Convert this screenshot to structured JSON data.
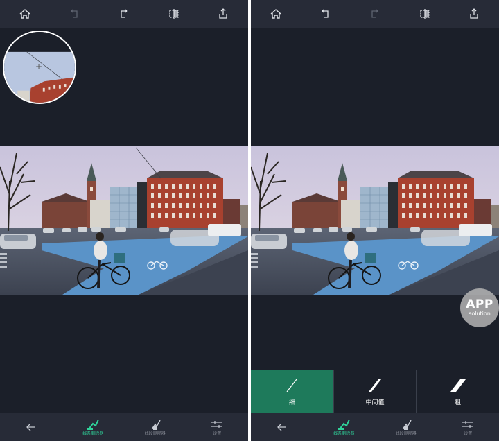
{
  "left_panel": {
    "bottom_nav": [
      {
        "icon": "back-arrow-icon",
        "label": ""
      },
      {
        "icon": "line-remover-icon",
        "label": "线条删除器",
        "active": true
      },
      {
        "icon": "wire-remover-icon",
        "label": "线段删除器",
        "active": false
      },
      {
        "icon": "settings-sliders-icon",
        "label": "设置",
        "active": false
      }
    ]
  },
  "right_panel": {
    "thickness_options": [
      {
        "label": "细",
        "selected": true
      },
      {
        "label": "中间值",
        "selected": false
      },
      {
        "label": "粗",
        "selected": false
      }
    ],
    "bottom_nav": [
      {
        "icon": "back-arrow-icon",
        "label": ""
      },
      {
        "icon": "line-remover-icon",
        "label": "线条删除器",
        "active": true
      },
      {
        "icon": "wire-remover-icon",
        "label": "线段删除器",
        "active": false
      },
      {
        "icon": "settings-sliders-icon",
        "label": "设置",
        "active": false
      }
    ]
  },
  "watermark": {
    "main": "APP",
    "sub": "solution"
  },
  "colors": {
    "background": "#1b1f29",
    "toolbar": "#272b37",
    "accent": "#2fd39a",
    "selected_option": "#1e7a5b"
  }
}
